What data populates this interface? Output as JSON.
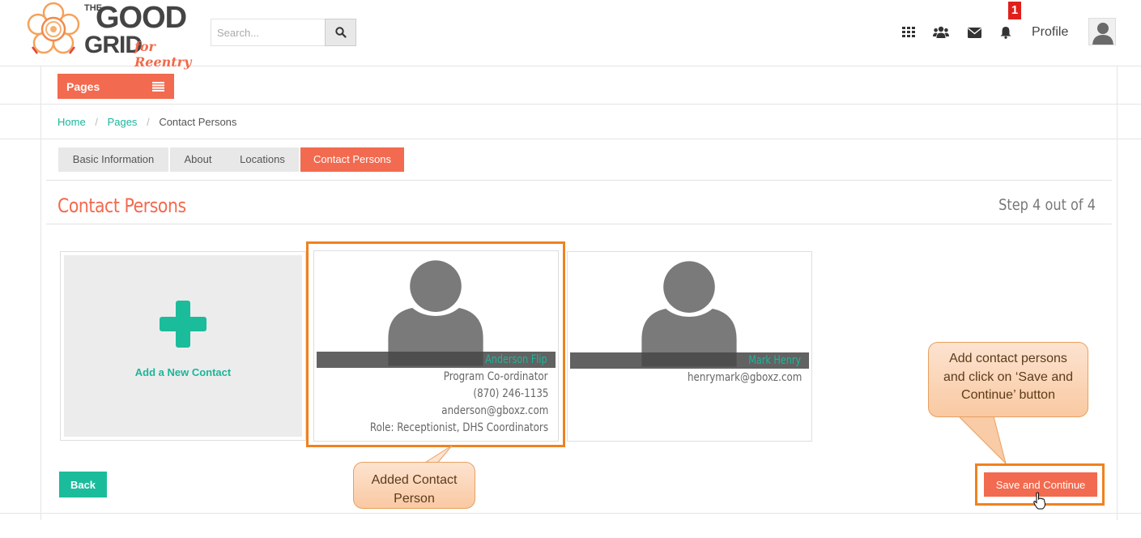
{
  "header": {
    "logo": {
      "the": "THE",
      "good": "GOOD",
      "grid": "GRID",
      "tagline": "for Reentry"
    },
    "search": {
      "placeholder": "Search..."
    },
    "icons": [
      "apps-grid-icon",
      "users-icon",
      "envelope-icon",
      "bell-icon",
      "search-icon"
    ],
    "notification_count": "1",
    "profile_label": "Profile"
  },
  "pages_button": {
    "label": "Pages"
  },
  "breadcrumb": {
    "home": "Home",
    "pages": "Pages",
    "current": "Contact Persons",
    "separator": "/"
  },
  "tabs": [
    {
      "label": "Basic Information",
      "active": false
    },
    {
      "label": "About",
      "active": false
    },
    {
      "label": "Locations",
      "active": false
    },
    {
      "label": "Contact Persons",
      "active": true
    }
  ],
  "section": {
    "title": "Contact Persons",
    "step": "Step 4 out of 4"
  },
  "add_contact": {
    "label": "Add a New Contact"
  },
  "contacts": [
    {
      "name": "Anderson Flip",
      "title": "Program Co-ordinator",
      "phone": "(870) 246-1135",
      "email": "anderson@gboxz.com",
      "role": "Role: Receptionist, DHS Coordinators"
    },
    {
      "name": "Mark Henry",
      "email": "henrymark@gboxz.com"
    }
  ],
  "callouts": {
    "added": "Added Contact Person",
    "instruction": "Add contact persons and click on ‘Save and Continue’ button"
  },
  "buttons": {
    "back": "Back",
    "save": "Save and Continue"
  },
  "colors": {
    "accent": "#f26a4f",
    "teal": "#1bb69a",
    "highlight": "#f0821e",
    "badge": "#e0201b"
  }
}
